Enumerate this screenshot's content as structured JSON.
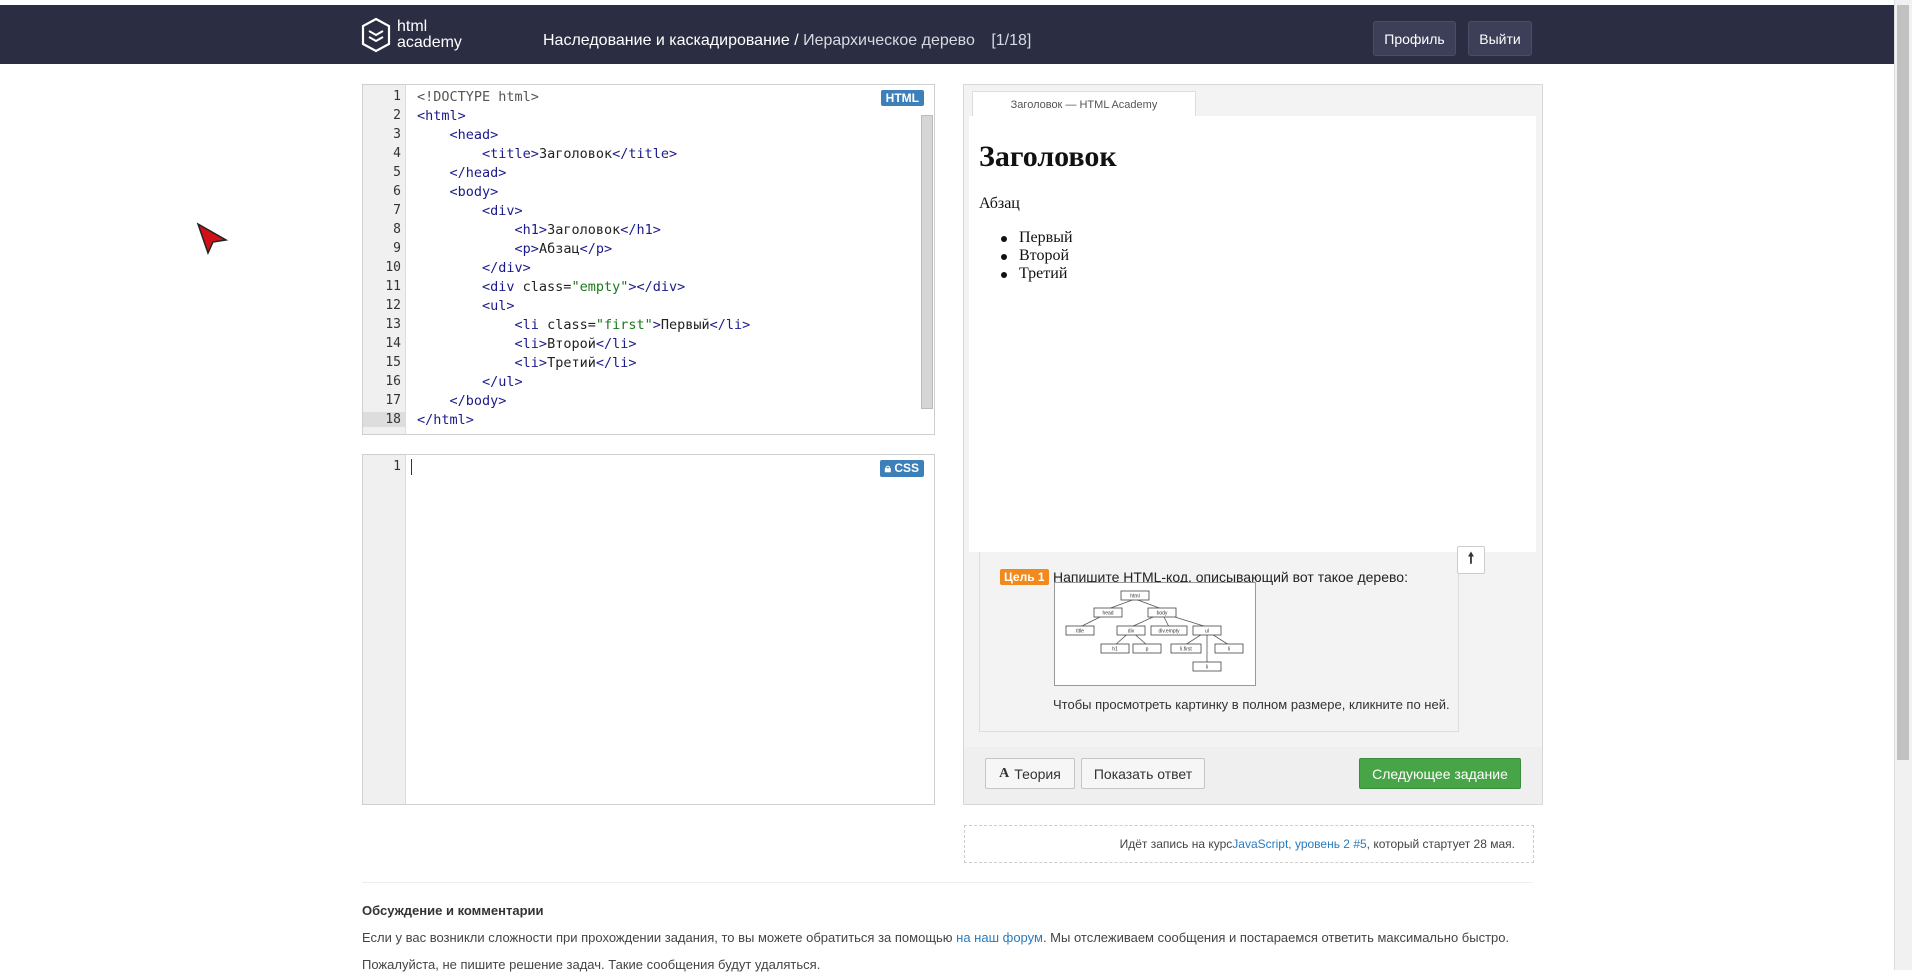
{
  "header": {
    "logo_line1": "html",
    "logo_line2": "academy",
    "crumb_main": "Наследование и каскадирование /",
    "crumb_sub": "Иерархическое дерево",
    "crumb_count": "[1/18]",
    "profile_label": "Профиль",
    "logout_label": "Выйти"
  },
  "html_editor": {
    "badge": "HTML",
    "lines": [
      {
        "n": "1",
        "parts": [
          {
            "c": "doc",
            "t": "<!DOCTYPE html>"
          }
        ]
      },
      {
        "n": "2",
        "parts": [
          {
            "c": "tag",
            "t": "<html>"
          }
        ]
      },
      {
        "n": "3",
        "parts": [
          {
            "c": "",
            "t": "    "
          },
          {
            "c": "tag",
            "t": "<head>"
          }
        ]
      },
      {
        "n": "4",
        "parts": [
          {
            "c": "",
            "t": "        "
          },
          {
            "c": "tag",
            "t": "<title>"
          },
          {
            "c": "",
            "t": "Заголовок"
          },
          {
            "c": "tag",
            "t": "</title>"
          }
        ]
      },
      {
        "n": "5",
        "parts": [
          {
            "c": "",
            "t": "    "
          },
          {
            "c": "tag",
            "t": "</head>"
          }
        ]
      },
      {
        "n": "6",
        "parts": [
          {
            "c": "",
            "t": "    "
          },
          {
            "c": "tag",
            "t": "<body>"
          }
        ]
      },
      {
        "n": "7",
        "parts": [
          {
            "c": "",
            "t": "        "
          },
          {
            "c": "tag",
            "t": "<div>"
          }
        ]
      },
      {
        "n": "8",
        "parts": [
          {
            "c": "",
            "t": "            "
          },
          {
            "c": "tag",
            "t": "<h1>"
          },
          {
            "c": "",
            "t": "Заголовок"
          },
          {
            "c": "tag",
            "t": "</h1>"
          }
        ]
      },
      {
        "n": "9",
        "parts": [
          {
            "c": "",
            "t": "            "
          },
          {
            "c": "tag",
            "t": "<p>"
          },
          {
            "c": "",
            "t": "Абзац"
          },
          {
            "c": "tag",
            "t": "</p>"
          }
        ]
      },
      {
        "n": "10",
        "parts": [
          {
            "c": "",
            "t": "        "
          },
          {
            "c": "tag",
            "t": "</div>"
          }
        ]
      },
      {
        "n": "11",
        "parts": [
          {
            "c": "",
            "t": "        "
          },
          {
            "c": "tag",
            "t": "<div "
          },
          {
            "c": "",
            "t": "class="
          },
          {
            "c": "str",
            "t": "\"empty\""
          },
          {
            "c": "tag",
            "t": "></div>"
          }
        ]
      },
      {
        "n": "12",
        "parts": [
          {
            "c": "",
            "t": "        "
          },
          {
            "c": "tag",
            "t": "<ul>"
          }
        ]
      },
      {
        "n": "13",
        "parts": [
          {
            "c": "",
            "t": "            "
          },
          {
            "c": "tag",
            "t": "<li "
          },
          {
            "c": "",
            "t": "class="
          },
          {
            "c": "str",
            "t": "\"first\""
          },
          {
            "c": "tag",
            "t": ">"
          },
          {
            "c": "",
            "t": "Первый"
          },
          {
            "c": "tag",
            "t": "</li>"
          }
        ]
      },
      {
        "n": "14",
        "parts": [
          {
            "c": "",
            "t": "            "
          },
          {
            "c": "tag",
            "t": "<li>"
          },
          {
            "c": "",
            "t": "Второй"
          },
          {
            "c": "tag",
            "t": "</li>"
          }
        ]
      },
      {
        "n": "15",
        "parts": [
          {
            "c": "",
            "t": "            "
          },
          {
            "c": "tag",
            "t": "<li>"
          },
          {
            "c": "",
            "t": "Третий"
          },
          {
            "c": "tag",
            "t": "</li>"
          }
        ]
      },
      {
        "n": "16",
        "parts": [
          {
            "c": "",
            "t": "        "
          },
          {
            "c": "tag",
            "t": "</ul>"
          }
        ]
      },
      {
        "n": "17",
        "parts": [
          {
            "c": "",
            "t": "    "
          },
          {
            "c": "tag",
            "t": "</body>"
          }
        ]
      },
      {
        "n": "18",
        "parts": [
          {
            "c": "tag",
            "t": "</html>"
          }
        ]
      }
    ]
  },
  "css_editor": {
    "badge": "CSS",
    "line": "1"
  },
  "preview": {
    "tab_title": "Заголовок — HTML Academy",
    "heading": "Заголовок",
    "paragraph": "Абзац",
    "list": [
      "Первый",
      "Второй",
      "Третий"
    ]
  },
  "task": {
    "goal_label": "Цель 1",
    "goal_text": "Напишите HTML-код, описывающий вот такое дерево:",
    "hint": "Чтобы просмотреть картинку в полном размере, кликните по ней.",
    "tree_nodes": [
      "html",
      "head",
      "body",
      "title",
      "div",
      "div.empty",
      "ul",
      "h1",
      "p",
      "li.first",
      "li",
      "li"
    ]
  },
  "buttons": {
    "theory": "Теория",
    "show_answer": "Показать ответ",
    "next": "Следующее задание"
  },
  "announce": {
    "pre": "Идёт запись на курс ",
    "link": "JavaScript, уровень 2 #5",
    "post": ", который стартует 28 мая."
  },
  "discussion": {
    "title": "Обсуждение и комментарии",
    "text1_pre": "Если у вас возникли сложности при прохождении задания, то вы можете обратиться за помощью ",
    "text1_link": "на наш форум",
    "text1_post": ". Мы отслеживаем сообщения и постараемся ответить максимально быстро.",
    "text2": "Пожалуйста, не пишите решение задач. Такие сообщения будут удаляться."
  },
  "colors": {
    "header_bg": "#2b2d42",
    "accent_blue": "#3d7fb8",
    "goal_orange": "#f08a1c",
    "next_green": "#47a447"
  }
}
